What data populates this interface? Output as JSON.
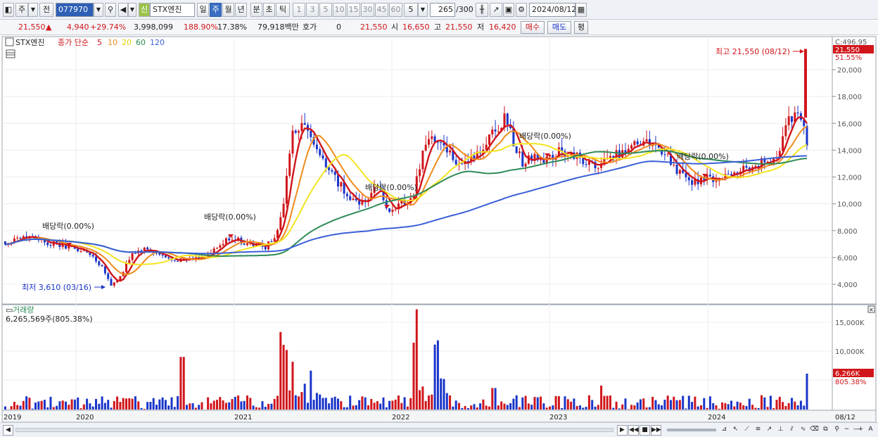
{
  "toolbar": {
    "period_label": "주",
    "prev_label": "전",
    "code_value": "077970",
    "new_label": "신",
    "name_value": "STX엔진",
    "tabs": [
      "일",
      "주",
      "월",
      "년",
      "분",
      "초",
      "틱"
    ],
    "numbers": [
      "1",
      "3",
      "5",
      "10",
      "15",
      "30",
      "45",
      "60"
    ],
    "n_select": "5",
    "count_value": "265",
    "count_total": "/300",
    "date_value": "2024/08/12"
  },
  "quote": {
    "price": "21,550",
    "change": "4,940",
    "change_pct": "+29.74%",
    "volume": "3,998,099",
    "vol_ratio": "188.90%",
    "turnover": "17.38%",
    "amount": "79,918백만",
    "hoga_label": "호가",
    "hoga_value": "0",
    "hoga_price": "21,550",
    "open_label": "시",
    "open": "16,650",
    "high_label": "고",
    "high": "21,550",
    "low_label": "저",
    "low": "16,420",
    "buy_label": "매수",
    "sell_label": "매도",
    "eval_label": "평"
  },
  "price_chart": {
    "legend_name": "STX엔진",
    "legend_text": "종가 단순",
    "ma_labels": [
      "5",
      "10",
      "20",
      "60",
      "120"
    ],
    "ma_colors": [
      "#d0161b",
      "#f08a1c",
      "#f2e520",
      "#2e8b57",
      "#3a5fd8"
    ],
    "high_annotation": "최고 21,550 (08/12)",
    "low_annotation": "최저 3,610 (03/16)",
    "dividend_labels": [
      "배당락(0.00%)",
      "배당락(0.00%)",
      "배당락(0.00%)",
      "배당락(0.00%)",
      "배당락(0.00%)"
    ],
    "price_tag": "21,550",
    "pct_tag": "51.55%",
    "top_label": "C:496.95",
    "y_ticks": [
      "20,000",
      "18,000",
      "16,000",
      "14,000",
      "12,000",
      "10,000",
      "8,000",
      "6,000",
      "4,000"
    ]
  },
  "volume_chart": {
    "title": "거래량",
    "info": "6,265,569주(805.38%)",
    "y_ticks": [
      "15,000K",
      "10,000K"
    ],
    "vol_tag": "6,266K",
    "pct_tag": "805.38%"
  },
  "x_axis": {
    "years": [
      "2019",
      "2020",
      "2021",
      "2022",
      "2023",
      "2024"
    ],
    "end_label": "08/12"
  }
}
